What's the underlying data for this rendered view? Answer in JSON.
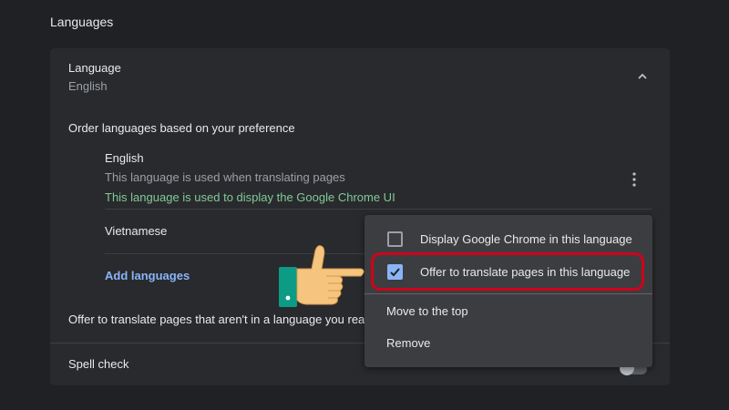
{
  "section": {
    "title": "Languages"
  },
  "language": {
    "header_label": "Language",
    "current": "English",
    "order_label": "Order languages based on your preference",
    "items": [
      {
        "name": "English",
        "note": "This language is used when translating pages",
        "ui_note": "This language is used to display the Google Chrome UI"
      },
      {
        "name": "Vietnamese"
      }
    ],
    "add_label": "Add languages",
    "offer_translate_label": "Offer to translate pages that aren't in a language you read"
  },
  "spell_check": {
    "label": "Spell check",
    "enabled": false
  },
  "menu": {
    "items": [
      {
        "label": "Display Google Chrome in this language",
        "checked": false
      },
      {
        "label": "Offer to translate pages in this language",
        "checked": true
      },
      {
        "label": "Move to the top"
      },
      {
        "label": "Remove"
      }
    ]
  },
  "colors": {
    "background": "#202124",
    "card": "#292a2d",
    "accent_blue": "#8ab4f8",
    "ui_green": "#81c995",
    "highlight_red": "#d0021b"
  },
  "icons": [
    "chevron-up-icon",
    "more-vert-icon",
    "checkbox-icon",
    "pointing-hand-icon"
  ]
}
